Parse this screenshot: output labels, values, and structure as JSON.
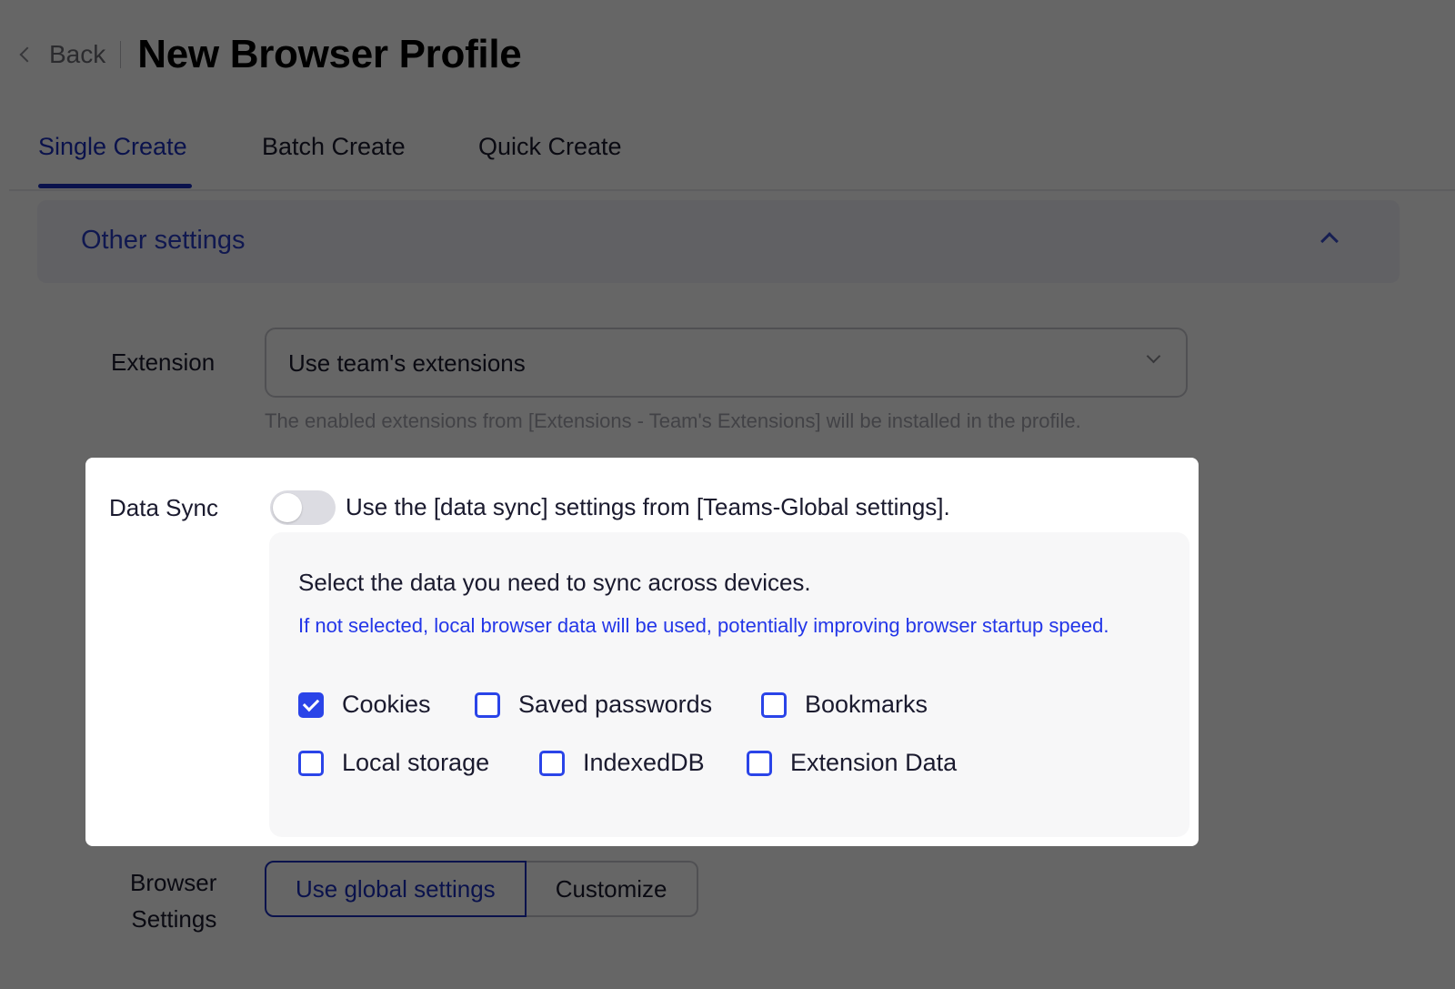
{
  "header": {
    "back_label": "Back",
    "title": "New Browser Profile"
  },
  "tabs": [
    {
      "label": "Single Create",
      "active": true
    },
    {
      "label": "Batch Create",
      "active": false
    },
    {
      "label": "Quick Create",
      "active": false
    }
  ],
  "section": {
    "title": "Other settings",
    "expanded": true
  },
  "extension": {
    "label": "Extension",
    "value": "Use team's extensions",
    "hint": "The enabled extensions from [Extensions - Team's Extensions] will be installed in the profile."
  },
  "data_sync": {
    "label": "Data Sync",
    "toggle_on": false,
    "toggle_text": "Use the [data sync] settings from [Teams-Global settings].",
    "panel_title": "Select the data you need to sync across devices.",
    "panel_note": "If not selected, local browser data will be used, potentially improving browser startup speed.",
    "options": [
      {
        "label": "Cookies",
        "checked": true
      },
      {
        "label": "Saved passwords",
        "checked": false
      },
      {
        "label": "Bookmarks",
        "checked": false
      },
      {
        "label": "Local storage",
        "checked": false
      },
      {
        "label": "IndexedDB",
        "checked": false
      },
      {
        "label": "Extension Data",
        "checked": false
      }
    ]
  },
  "browser_settings": {
    "label_line1": "Browser",
    "label_line2": "Settings",
    "options": [
      {
        "label": "Use global settings",
        "selected": true
      },
      {
        "label": "Customize",
        "selected": false
      }
    ]
  },
  "colors": {
    "accent": "#1a2fbf",
    "checkbox": "#2a44e8",
    "note": "#2336e8"
  }
}
